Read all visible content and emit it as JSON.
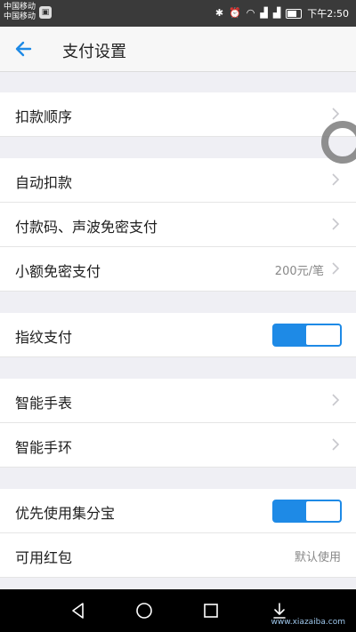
{
  "status_bar": {
    "carrier1": "中国移动",
    "carrier2": "中国移动",
    "time": "下午2:50"
  },
  "header": {
    "title": "支付设置"
  },
  "rows": [
    {
      "label": "扣款顺序"
    },
    {
      "label": "自动扣款"
    },
    {
      "label": "付款码、声波免密支付"
    },
    {
      "label": "小额免密支付",
      "value": "200元/笔"
    },
    {
      "label": "指纹支付",
      "toggle": "on"
    },
    {
      "label": "智能手表"
    },
    {
      "label": "智能手环"
    },
    {
      "label": "优先使用集分宝",
      "toggle": "on"
    },
    {
      "label": "可用红包",
      "value": "默认使用"
    }
  ],
  "colors": {
    "accent": "#1e8ae6",
    "background": "#efeff4"
  },
  "watermark": "www.xiazaiba.com"
}
